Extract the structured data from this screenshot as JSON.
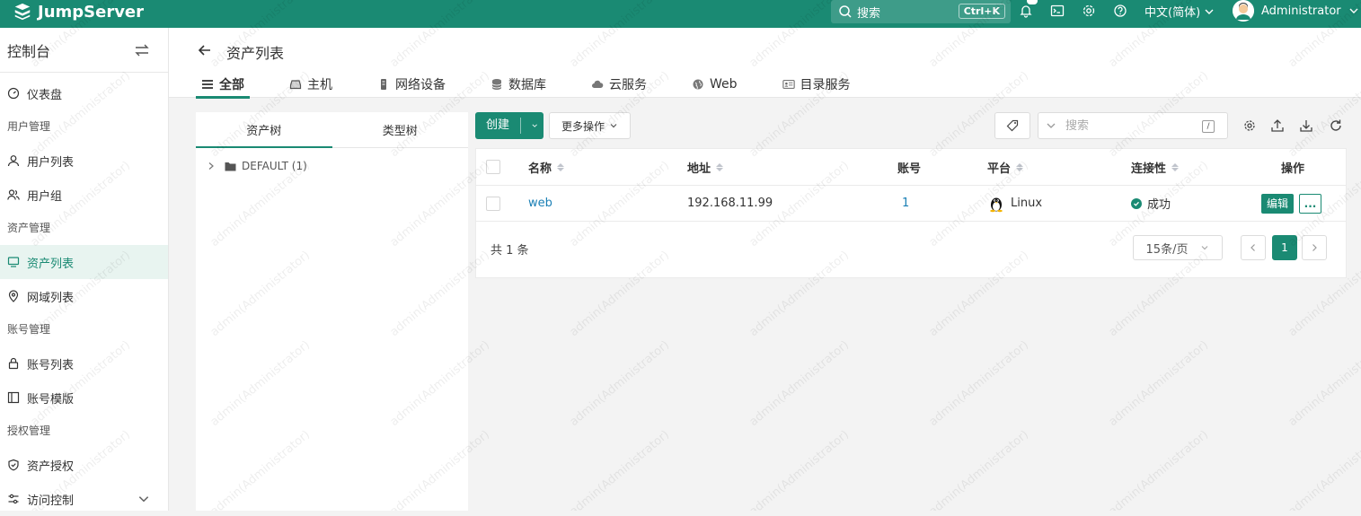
{
  "app": {
    "brand": "JumpServer"
  },
  "topbar": {
    "search_placeholder": "搜索",
    "search_shortcut": "Ctrl+K",
    "notification_count": "",
    "language": "中文(简体)",
    "username": "Administrator"
  },
  "sidebar": {
    "title": "控制台",
    "groups": {
      "dashboard": "仪表盘",
      "user_mgmt": "用户管理",
      "user_list": "用户列表",
      "user_group": "用户组",
      "asset_mgmt": "资产管理",
      "asset_list": "资产列表",
      "domain_list": "网域列表",
      "account_mgmt": "账号管理",
      "account_list": "账号列表",
      "account_template": "账号模版",
      "perm_mgmt": "授权管理",
      "asset_perm": "资产授权",
      "access_control": "访问控制"
    }
  },
  "page": {
    "title": "资产列表",
    "tabs": [
      "全部",
      "主机",
      "网络设备",
      "数据库",
      "云服务",
      "Web",
      "目录服务"
    ]
  },
  "tree": {
    "tabs": [
      "资产树",
      "类型树"
    ],
    "root": "DEFAULT (1)"
  },
  "toolbar": {
    "create": "创建",
    "more": "更多操作",
    "search_placeholder": "搜索",
    "slash": "/"
  },
  "table": {
    "columns": {
      "name": "名称",
      "address": "地址",
      "accounts": "账号",
      "platform": "平台",
      "connectivity": "连接性",
      "actions": "操作"
    },
    "rows": [
      {
        "name": "web",
        "address": "192.168.11.99",
        "accounts": "1",
        "platform": "Linux",
        "connectivity": "成功",
        "edit": "编辑",
        "more": "..."
      }
    ]
  },
  "pagination": {
    "total": "共 1 条",
    "page_size": "15条/页",
    "current": "1"
  },
  "watermark": "admin(Administrator)",
  "colors": {
    "primary": "#1a8a73",
    "link": "#1a7fb5"
  }
}
